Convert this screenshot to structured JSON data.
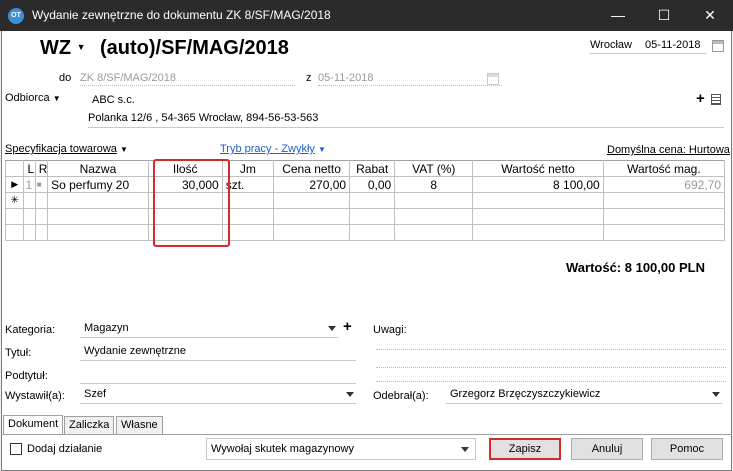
{
  "window": {
    "title": "Wydanie zewnętrzne do dokumentu ZK 8/SF/MAG/2018",
    "app_icon": "OT",
    "minimize": "—",
    "maximize": "☐",
    "close": "✕"
  },
  "header": {
    "doc_type": "WZ",
    "doc_number": "(auto)/SF/MAG/2018",
    "place": "Wrocław",
    "date": "05-11-2018",
    "do_label": "do",
    "do_value": "ZK 8/SF/MAG/2018",
    "z_label": "z",
    "z_value": "05-11-2018"
  },
  "recipient": {
    "label": "Odbiorca",
    "name": "ABC s.c.",
    "address": "Polanka  12/6 , 54-365 Wrocław, 894-56-53-563",
    "add_symbol": "+"
  },
  "spec": {
    "label": "Specyfikacja towarowa",
    "mode": "Tryb pracy - Zwykły",
    "default_price": "Domyślna cena: Hurtowa"
  },
  "table": {
    "columns": [
      "",
      "L",
      "R",
      "Nazwa",
      "Ilość",
      "Jm",
      "Cena netto",
      "Rabat",
      "VAT (%)",
      "Wartość netto",
      "Wartość mag."
    ],
    "rows": [
      {
        "marker": "▶",
        "l": "1",
        "r": "■",
        "name": "So perfumy 20",
        "qty": "30,000",
        "unit": "szt.",
        "price": "270,00",
        "discount": "0,00",
        "vat": "8",
        "net": "8 100,00",
        "mag": "692,70"
      }
    ],
    "new_row_marker": "✳"
  },
  "total": {
    "text": "Wartość: 8 100,00 PLN"
  },
  "meta": {
    "kategoria_label": "Kategoria:",
    "kategoria_value": "Magazyn",
    "tytul_label": "Tytuł:",
    "tytul_value": "Wydanie zewnętrzne",
    "podtytul_label": "Podtytuł:",
    "podtytul_value": "",
    "wystawil_label": "Wystawił(a):",
    "wystawil_value": "Szef",
    "uwagi_label": "Uwagi:",
    "odebral_label": "Odebrał(a):",
    "odebral_value": "Grzegorz Brzęczyszczykiewicz",
    "add_symbol": "+"
  },
  "tabs": [
    "Dokument",
    "Zaliczka",
    "Własne"
  ],
  "footer": {
    "add_action": "Dodaj działanie",
    "action_select": "Wywołaj skutek magazynowy",
    "save": "Zapisz",
    "cancel": "Anuluj",
    "help": "Pomoc"
  },
  "colors": {
    "highlight_frame": "#d62b2b",
    "titlebar": "#2b2b2b",
    "link": "#2060c8"
  }
}
